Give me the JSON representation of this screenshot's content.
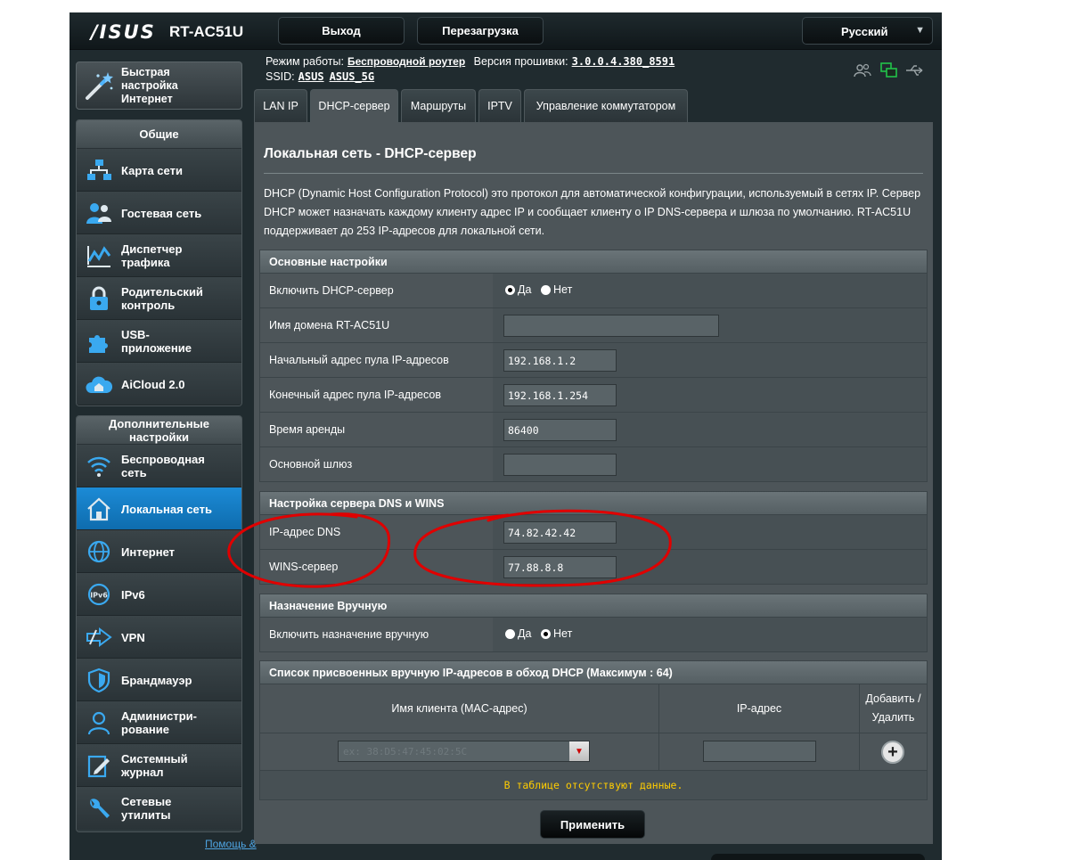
{
  "header": {
    "logo": "/ISUS",
    "model": "RT-AC51U",
    "logout_label": "Выход",
    "reboot_label": "Перезагрузка",
    "language": "Русский"
  },
  "info": {
    "mode_label": "Режим работы:",
    "mode_value": "Беспроводной роутер",
    "firmware_label": "Версия прошивки:",
    "firmware_value": "3.0.0.4.380_8591",
    "ssid_label": "SSID:",
    "ssid_1": "ASUS",
    "ssid_2": "ASUS_5G"
  },
  "sidebar": {
    "quick_setup": "Быстрая настройка Интернет",
    "general_header": "Общие",
    "general_items": [
      {
        "label": "Карта сети",
        "icon": "network-map-icon"
      },
      {
        "label": "Гостевая сеть",
        "icon": "guest-network-icon"
      },
      {
        "label": "Диспетчер трафика",
        "icon": "traffic-manager-icon"
      },
      {
        "label": "Родительский контроль",
        "icon": "parental-control-icon"
      },
      {
        "label": "USB-приложение",
        "icon": "usb-app-icon"
      },
      {
        "label": "AiCloud 2.0",
        "icon": "aicloud-icon"
      }
    ],
    "advanced_header": "Дополнительные настройки",
    "advanced_items": [
      {
        "label": "Беспроводная сеть",
        "icon": "wireless-icon"
      },
      {
        "label": "Локальная сеть",
        "icon": "lan-icon",
        "active": true
      },
      {
        "label": "Интернет",
        "icon": "internet-icon"
      },
      {
        "label": "IPv6",
        "icon": "ipv6-icon"
      },
      {
        "label": "VPN",
        "icon": "vpn-icon"
      },
      {
        "label": "Брандмауэр",
        "icon": "firewall-icon"
      },
      {
        "label": "Администри-рование",
        "icon": "administration-icon"
      },
      {
        "label": "Системный журнал",
        "icon": "system-log-icon"
      },
      {
        "label": "Сетевые утилиты",
        "icon": "network-tools-icon"
      }
    ]
  },
  "tabs": [
    "LAN IP",
    "DHCP-сервер",
    "Маршруты",
    "IPTV",
    "Управление коммутатором"
  ],
  "active_tab": "DHCP-сервер",
  "main": {
    "title": "Локальная сеть - DHCP-сервер",
    "description": "DHCP (Dynamic Host Configuration Protocol) это протокол для автоматической конфигурации, используемый в сетях IP. Сервер DHCP может назначать каждому клиенту адрес IP и сообщает клиенту о IP DNS-сервера и шлюза по умолчанию. RT-AC51U поддерживает до 253 IP-адресов для локальной сети."
  },
  "basic": {
    "header": "Основные настройки",
    "enable_dhcp_label": "Включить DHCP-сервер",
    "yes": "Да",
    "no": "Нет",
    "enable_dhcp_value": "Да",
    "domain_label": "Имя домена RT-AC51U",
    "domain_value": "",
    "pool_start_label": "Начальный адрес пула IP-адресов",
    "pool_start_value": "192.168.1.2",
    "pool_end_label": "Конечный адрес пула IP-адресов",
    "pool_end_value": "192.168.1.254",
    "lease_label": "Время аренды",
    "lease_value": "86400",
    "gateway_label": "Основной шлюз",
    "gateway_value": ""
  },
  "dns": {
    "header": "Настройка сервера DNS и WINS",
    "dns_label": "IP-адрес DNS",
    "dns_value": "74.82.42.42",
    "wins_label": "WINS-сервер",
    "wins_value": "77.88.8.8"
  },
  "manual": {
    "header": "Назначение Вручную",
    "enable_label": "Включить назначение вручную",
    "value": "Нет"
  },
  "manual_list": {
    "header": "Список присвоенных вручную IP-адресов в обход DHCP (Максимум : 64)",
    "col_client": "Имя клиента (MAC-адрес)",
    "col_ip": "IP-адрес",
    "col_add": "Добавить / Удалить",
    "mac_placeholder": "ex: 38:D5:47:45:02:5C",
    "empty_text": "В таблице отсутствуют данные."
  },
  "apply_label": "Применить",
  "footer_link": "Помощь &",
  "colors": {
    "accent_active": "#1c8bd6",
    "annotation": "#e00000",
    "empty_notice": "#ffcc00"
  }
}
